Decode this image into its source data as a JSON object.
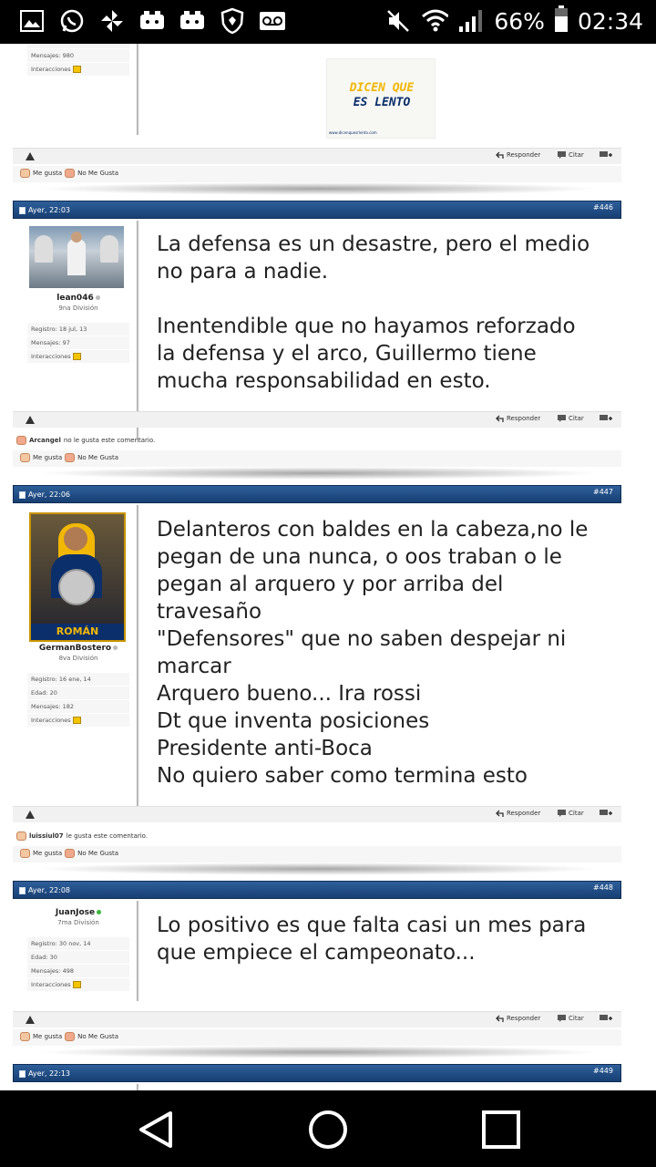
{
  "status_bar": {
    "battery": "66%",
    "time": "02:34",
    "icons": [
      "gallery-icon",
      "whatsapp-icon",
      "pinwheel-icon",
      "game-controller-icon",
      "game-controller-icon",
      "shield-icon",
      "voicemail-icon",
      "mute-icon",
      "wifi-icon",
      "signal-icon",
      "battery-icon"
    ]
  },
  "top_post": {
    "user_stats": [
      {
        "label": "Mensajes:",
        "value": "980"
      },
      {
        "label": "Interacciones",
        "value": ""
      }
    ],
    "image_text": [
      "DICEN QUE",
      "ES LENTO"
    ],
    "image_caption": "www.dicenquesrlento.com"
  },
  "actions": {
    "reply": "Responder",
    "quote": "Citar",
    "like": "Me gusta",
    "dislike": "No Me Gusta"
  },
  "posts": [
    {
      "date": "Ayer, 22:03",
      "number": "#446",
      "username": "lean046",
      "rank": "9na División",
      "online": false,
      "stats": [
        {
          "label": "Registro:",
          "value": "18 jul, 13"
        },
        {
          "label": "Mensajes:",
          "value": "97"
        },
        {
          "label": "Interacciones",
          "value": ""
        }
      ],
      "message": "La defensa es un desastre, pero el medio\nno para a nadie.\n\nInentendible que no hayamos reforzado\nla defensa y el arco, Guillermo tiene\nmucha responsabilidad en esto.",
      "reaction_user": "Arcangel",
      "reaction_text": "no le gusta este comentario."
    },
    {
      "date": "Ayer, 22:06",
      "number": "#447",
      "username": "GermanBostero",
      "rank": "8va División",
      "online": false,
      "avatar_caption": "ROMÁN",
      "stats": [
        {
          "label": "Registro:",
          "value": "16 ene, 14"
        },
        {
          "label": "Edad:",
          "value": "20"
        },
        {
          "label": "Mensajes:",
          "value": "182"
        },
        {
          "label": "Interacciones",
          "value": ""
        }
      ],
      "message": "Delanteros con baldes en la cabeza,no le\npegan de una nunca, o oos traban o le\npegan al arquero y por arriba del\ntravesaño\n\"Defensores\" que no saben despejar ni\nmarcar\nArquero bueno... Ira rossi\nDt que inventa posiciones\nPresidente anti-Boca\nNo quiero saber como termina esto",
      "reaction_user": "luissiul07",
      "reaction_text": "le gusta este comentario."
    },
    {
      "date": "Ayer, 22:08",
      "number": "#448",
      "username": "JuanJose",
      "rank": "7ma División",
      "online": true,
      "stats": [
        {
          "label": "Registro:",
          "value": "30 nov, 14"
        },
        {
          "label": "Edad:",
          "value": "30"
        },
        {
          "label": "Mensajes:",
          "value": "498"
        },
        {
          "label": "Interacciones",
          "value": ""
        }
      ],
      "message": "Lo positivo es que falta casi un mes para\nque empiece el campeonato..."
    },
    {
      "date": "Ayer, 22:13",
      "number": "#449"
    }
  ],
  "colors": {
    "header_blue": "#1f4d85",
    "boca_yellow": "#f2b705",
    "boca_blue": "#0b2f6b"
  }
}
